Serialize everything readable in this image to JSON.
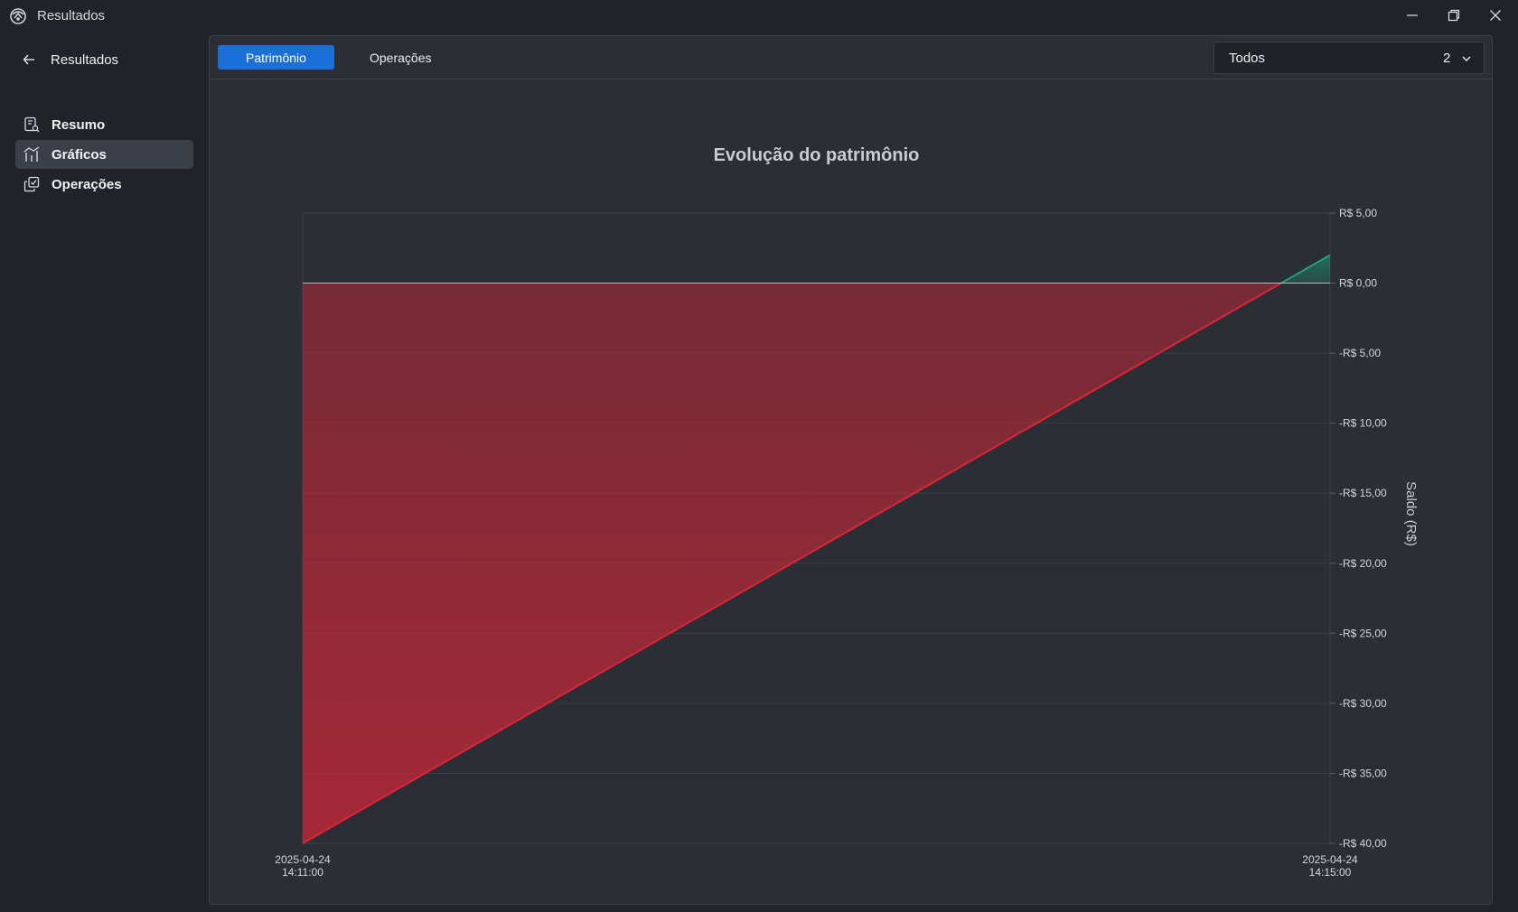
{
  "window": {
    "title": "Resultados"
  },
  "sidebar": {
    "back_label": "Resultados",
    "items": [
      {
        "label": "Resumo",
        "icon": "report-search-icon",
        "active": false
      },
      {
        "label": "Gráficos",
        "icon": "chart-icon",
        "active": true
      },
      {
        "label": "Operações",
        "icon": "operations-icon",
        "active": false
      }
    ]
  },
  "tabs": [
    {
      "label": "Patrimônio",
      "active": true
    },
    {
      "label": "Operações",
      "active": false
    }
  ],
  "filter": {
    "value": "Todos",
    "count": "2"
  },
  "colors": {
    "accent": "#1b6fd8",
    "negative": "#dc2638",
    "positive": "#1fa37a"
  },
  "chart_data": {
    "type": "area",
    "title": "Evolução do patrimônio",
    "xlabel": "",
    "ylabel": "Saldo (R$)",
    "x": [
      "2025-04-24 14:11:00",
      "2025-04-24 14:15:00"
    ],
    "x_tick_labels": [
      {
        "date": "2025-04-24",
        "time": "14:11:00"
      },
      {
        "date": "2025-04-24",
        "time": "14:15:00"
      }
    ],
    "series": [
      {
        "values": [
          -40.0,
          2.0
        ]
      }
    ],
    "ylim": [
      -40,
      5
    ],
    "y_ticks": [
      5,
      0,
      -5,
      -10,
      -15,
      -20,
      -25,
      -30,
      -35,
      -40
    ],
    "y_tick_labels": [
      "R$ 5,00",
      "R$ 0,00",
      "-R$ 5,00",
      "-R$ 10,00",
      "-R$ 15,00",
      "-R$ 20,00",
      "-R$ 25,00",
      "-R$ 30,00",
      "-R$ 35,00",
      "-R$ 40,00"
    ],
    "y_axis_side": "right",
    "grid": true,
    "legend": "none"
  }
}
